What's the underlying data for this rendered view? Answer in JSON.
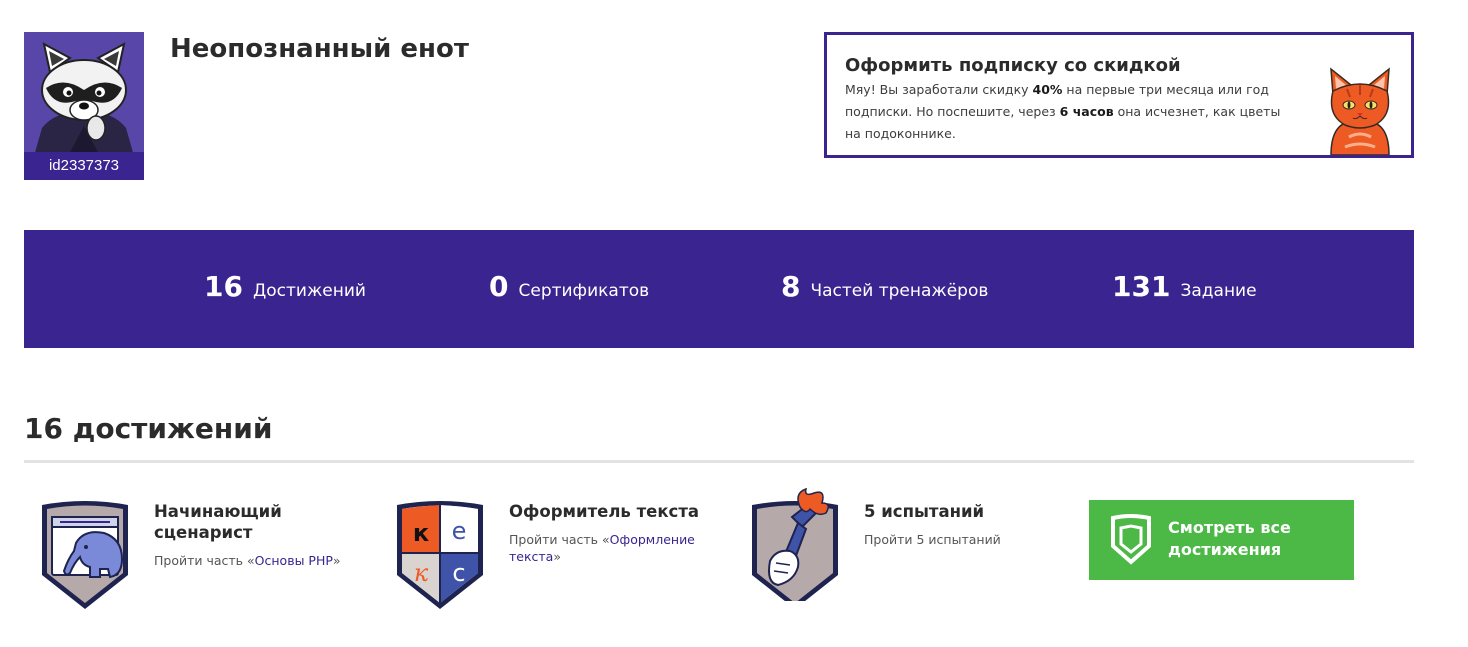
{
  "profile": {
    "name": "Неопознанный енот",
    "user_id": "id2337373"
  },
  "promo": {
    "title": "Оформить подписку со скидкой",
    "text_part1": "Мяу! Вы заработали скидку ",
    "discount": "40%",
    "text_part2": " на первые три месяца или год подписки. Но поспешите, через ",
    "time_left": "6 часов",
    "text_part3": " она исчезнет, как цветы на подоконнике."
  },
  "stats": [
    {
      "value": "16",
      "label": "Достижений"
    },
    {
      "value": "0",
      "label": "Сертификатов"
    },
    {
      "value": "8",
      "label": "Частей тренажёров"
    },
    {
      "value": "131",
      "label": "Задание"
    }
  ],
  "achievements": {
    "heading": "16 достижений",
    "items": [
      {
        "title": "Начинающий сценарист",
        "desc_prefix": "Пройти часть «",
        "link": "Основы PHP",
        "desc_suffix": "»"
      },
      {
        "title": "Оформитель текста",
        "desc_prefix": "Пройти часть «",
        "link": "Оформление текста",
        "desc_suffix": "»"
      },
      {
        "title": "5 испытаний",
        "desc_prefix": "Пройти 5 испытаний",
        "link": "",
        "desc_suffix": ""
      }
    ],
    "badge2_letters": [
      "к",
      "е",
      "к",
      "с"
    ],
    "view_all_label": "Смотреть все достижения"
  },
  "colors": {
    "brand_purple": "#3a2490",
    "green": "#4cb845",
    "orange": "#ee5a24"
  },
  "icons": {
    "avatar": "raccoon-avatar",
    "promo": "cat-icon",
    "badge1": "elephant-badge-icon",
    "badge2": "kekс-badge-icon",
    "badge3": "torch-badge-icon",
    "view_all": "shield-icon"
  }
}
